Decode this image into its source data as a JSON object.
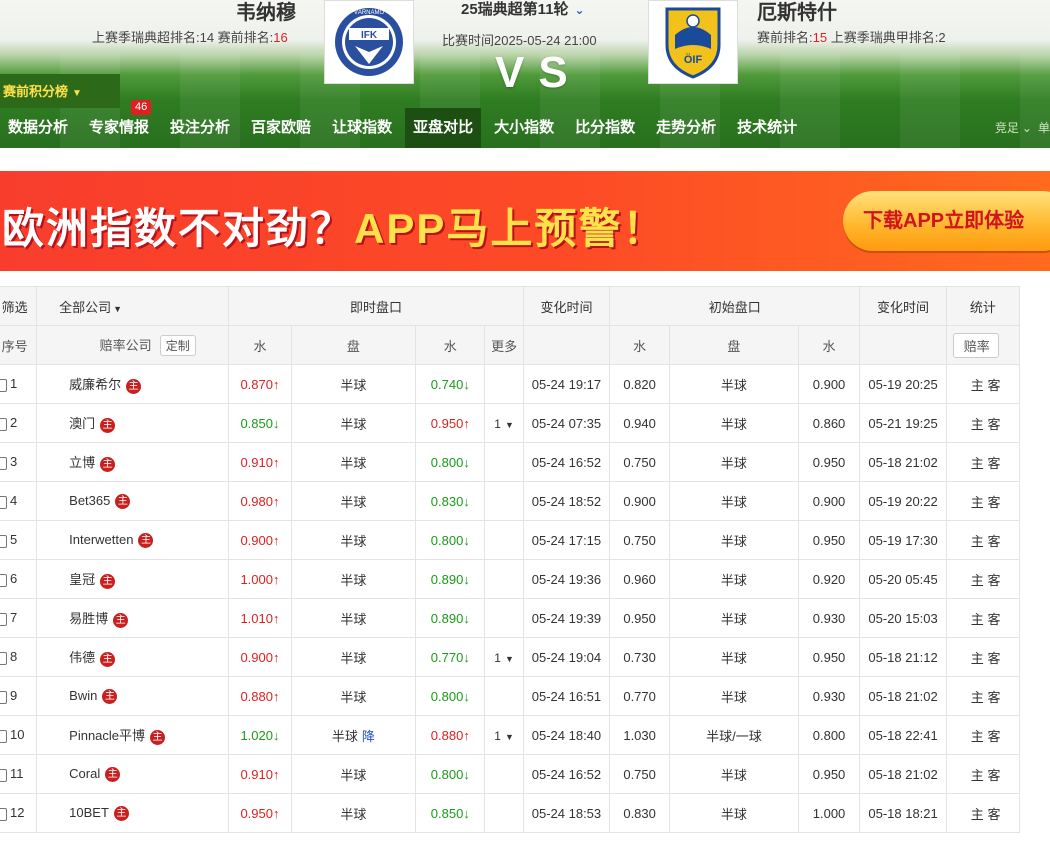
{
  "header": {
    "home_team": "韦纳穆",
    "away_team": "厄斯特什",
    "home_rank_label": "上赛季瑞典超排名:14   赛前排名:",
    "home_rank_value": "16",
    "away_rank_prefix": "赛前排名:",
    "away_rank_value": "15",
    "away_rank_suffix": "  上赛季瑞典甲排名:2",
    "league_round": "25瑞典超第11轮",
    "match_time": "比赛时间2025-05-24 21:00",
    "vs": "VS",
    "standing_button": "赛前积分榜",
    "home_logo_text": "IFK",
    "home_logo_ring": "VÄRNAMO",
    "away_logo_text": "ÖIF"
  },
  "nav": {
    "items": [
      {
        "label": "数据分析"
      },
      {
        "label": "专家情报",
        "badge": "46"
      },
      {
        "label": "投注分析"
      },
      {
        "label": "百家欧赔"
      },
      {
        "label": "让球指数"
      },
      {
        "label": "亚盘对比"
      },
      {
        "label": "大小指数"
      },
      {
        "label": "比分指数"
      },
      {
        "label": "走势分析"
      },
      {
        "label": "技术统计"
      }
    ],
    "right_a": "竞足",
    "right_b": "单"
  },
  "banner": {
    "text_a": "欧洲指数不对劲？",
    "text_b": "APP马上预警！",
    "button": "下载APP立即体验"
  },
  "table": {
    "filter_label": "筛选",
    "company_filter": "全部公司",
    "live_header": "即时盘口",
    "change_time_header": "变化时间",
    "initial_header": "初始盘口",
    "stats_header": "统计",
    "seq_header": "序号",
    "company_header": "赔率公司",
    "customize_button": "定制",
    "water_header": "水",
    "line_header": "盘",
    "more_header": "更多",
    "odds_stats_button": "赔率",
    "home_label": "主",
    "away_label": "客",
    "rows": [
      {
        "no": "1",
        "company": "威廉希尔",
        "w1": "0.870",
        "w1d": "up",
        "line": "半球",
        "line_tag": "",
        "w2": "0.740",
        "w2d": "down",
        "more": "",
        "time": "05-24 19:17",
        "iw1": "0.820",
        "iline": "半球",
        "iw2": "0.900",
        "itime": "05-19 20:25"
      },
      {
        "no": "2",
        "company": "澳门",
        "w1": "0.850",
        "w1d": "down",
        "line": "半球",
        "line_tag": "",
        "w2": "0.950",
        "w2d": "up",
        "more": "1",
        "time": "05-24 07:35",
        "iw1": "0.940",
        "iline": "半球",
        "iw2": "0.860",
        "itime": "05-21 19:25"
      },
      {
        "no": "3",
        "company": "立博",
        "w1": "0.910",
        "w1d": "up",
        "line": "半球",
        "line_tag": "",
        "w2": "0.800",
        "w2d": "down",
        "more": "",
        "time": "05-24 16:52",
        "iw1": "0.750",
        "iline": "半球",
        "iw2": "0.950",
        "itime": "05-18 21:02"
      },
      {
        "no": "4",
        "company": "Bet365",
        "w1": "0.980",
        "w1d": "up",
        "line": "半球",
        "line_tag": "",
        "w2": "0.830",
        "w2d": "down",
        "more": "",
        "time": "05-24 18:52",
        "iw1": "0.900",
        "iline": "半球",
        "iw2": "0.900",
        "itime": "05-19 20:22"
      },
      {
        "no": "5",
        "company": "Interwetten",
        "w1": "0.900",
        "w1d": "up",
        "line": "半球",
        "line_tag": "",
        "w2": "0.800",
        "w2d": "down",
        "more": "",
        "time": "05-24 17:15",
        "iw1": "0.750",
        "iline": "半球",
        "iw2": "0.950",
        "itime": "05-19 17:30"
      },
      {
        "no": "6",
        "company": "皇冠",
        "w1": "1.000",
        "w1d": "up",
        "line": "半球",
        "line_tag": "",
        "w2": "0.890",
        "w2d": "down",
        "more": "",
        "time": "05-24 19:36",
        "iw1": "0.960",
        "iline": "半球",
        "iw2": "0.920",
        "itime": "05-20 05:45"
      },
      {
        "no": "7",
        "company": "易胜博",
        "w1": "1.010",
        "w1d": "up",
        "line": "半球",
        "line_tag": "",
        "w2": "0.890",
        "w2d": "down",
        "more": "",
        "time": "05-24 19:39",
        "iw1": "0.950",
        "iline": "半球",
        "iw2": "0.930",
        "itime": "05-20 15:03"
      },
      {
        "no": "8",
        "company": "伟德",
        "w1": "0.900",
        "w1d": "up",
        "line": "半球",
        "line_tag": "",
        "w2": "0.770",
        "w2d": "down",
        "more": "1",
        "time": "05-24 19:04",
        "iw1": "0.730",
        "iline": "半球",
        "iw2": "0.950",
        "itime": "05-18 21:12"
      },
      {
        "no": "9",
        "company": "Bwin",
        "w1": "0.880",
        "w1d": "up",
        "line": "半球",
        "line_tag": "",
        "w2": "0.800",
        "w2d": "down",
        "more": "",
        "time": "05-24 16:51",
        "iw1": "0.770",
        "iline": "半球",
        "iw2": "0.930",
        "itime": "05-18 21:02"
      },
      {
        "no": "10",
        "company": "Pinnacle平博",
        "w1": "1.020",
        "w1d": "down",
        "line": "半球",
        "line_tag": "降",
        "w2": "0.880",
        "w2d": "up",
        "more": "1",
        "time": "05-24 18:40",
        "iw1": "1.030",
        "iline": "半球/一球",
        "iw2": "0.800",
        "itime": "05-18 22:41"
      },
      {
        "no": "11",
        "company": "Coral",
        "w1": "0.910",
        "w1d": "up",
        "line": "半球",
        "line_tag": "",
        "w2": "0.800",
        "w2d": "down",
        "more": "",
        "time": "05-24 16:52",
        "iw1": "0.750",
        "iline": "半球",
        "iw2": "0.950",
        "itime": "05-18 21:02"
      },
      {
        "no": "12",
        "company": "10BET",
        "w1": "0.950",
        "w1d": "up",
        "line": "半球",
        "line_tag": "",
        "w2": "0.850",
        "w2d": "down",
        "more": "",
        "time": "05-24 18:53",
        "iw1": "0.830",
        "iline": "半球",
        "iw2": "1.000",
        "itime": "05-18 18:21"
      }
    ]
  },
  "colors": {
    "nav_green": "#286f1e",
    "active_tab": "#1d4f12",
    "up_red": "#e02020",
    "down_green": "#1a9a1a",
    "badge_red": "#e02020"
  }
}
